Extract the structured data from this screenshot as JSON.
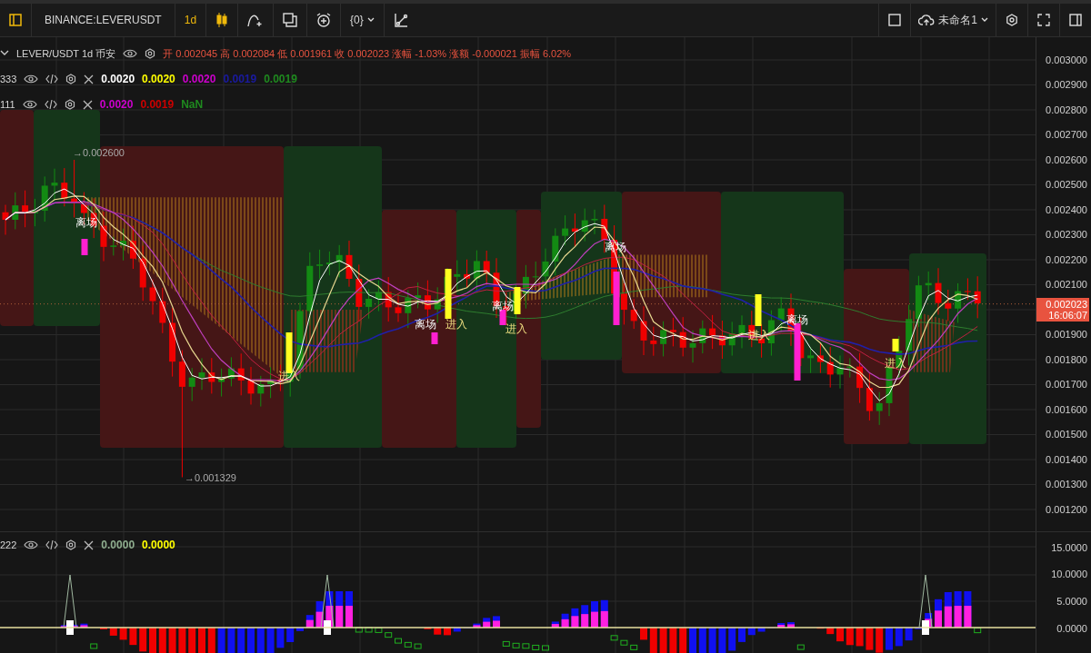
{
  "toolbar": {
    "symbol": "BINANCE:LEVERUSDT",
    "interval": "1d",
    "script_menu": "{0}",
    "layout_name": "未命名1"
  },
  "legend": {
    "title": "LEVER/USDT 1d 币安",
    "ohlc": "开 0.002045 高 0.002084 低 0.001961 收 0.002023 涨幅 -1.03% 涨额 -0.000021 振幅 6.02%"
  },
  "indicators": [
    {
      "label": "333",
      "values": [
        {
          "text": "0.0020",
          "color": "#ffffff"
        },
        {
          "text": "0.0020",
          "color": "#ffff00"
        },
        {
          "text": "0.0020",
          "color": "#cc00cc"
        },
        {
          "text": "0.0019",
          "color": "#1a1aa0"
        },
        {
          "text": "0.0019",
          "color": "#1f8a1f"
        }
      ]
    },
    {
      "label": "111",
      "values": [
        {
          "text": "0.0020",
          "color": "#cc00cc"
        },
        {
          "text": "0.0019",
          "color": "#cc0000"
        },
        {
          "text": "NaN",
          "color": "#1f8a1f"
        }
      ]
    }
  ],
  "annotations": [
    "→0.002600",
    "→0.001329"
  ],
  "signals": [
    {
      "kind": "exit",
      "text": "离场"
    },
    {
      "kind": "entry",
      "text": "进入"
    },
    {
      "kind": "exit",
      "text": "离场"
    },
    {
      "kind": "entry",
      "text": "进入"
    },
    {
      "kind": "exit",
      "text": "离场"
    },
    {
      "kind": "entry",
      "text": "进入"
    },
    {
      "kind": "exit",
      "text": "离场"
    },
    {
      "kind": "entry",
      "text": "进入"
    },
    {
      "kind": "exit",
      "text": "离场"
    },
    {
      "kind": "entry",
      "text": "进入"
    }
  ],
  "price_axis": {
    "labels_above": [
      "0.003000",
      "0.002900",
      "0.002800",
      "0.002700",
      "0.002600",
      "0.002500",
      "0.002400",
      "0.002300",
      "0.002200",
      "0.002100"
    ],
    "labels_below": [
      "0.001900",
      "0.001800",
      "0.001700",
      "0.001600",
      "0.001500",
      "0.001400",
      "0.001300",
      "0.001200"
    ],
    "last_price": "0.002023",
    "countdown": "16:06:07"
  },
  "oscillator": {
    "label": "222",
    "values": [
      {
        "text": "0.0000",
        "color": "#8fae8f"
      },
      {
        "text": "0.0000",
        "color": "#ffff00"
      }
    ],
    "axis_labels": [
      "15.0000",
      "10.0000",
      "5.0000",
      "0.0000"
    ]
  }
}
